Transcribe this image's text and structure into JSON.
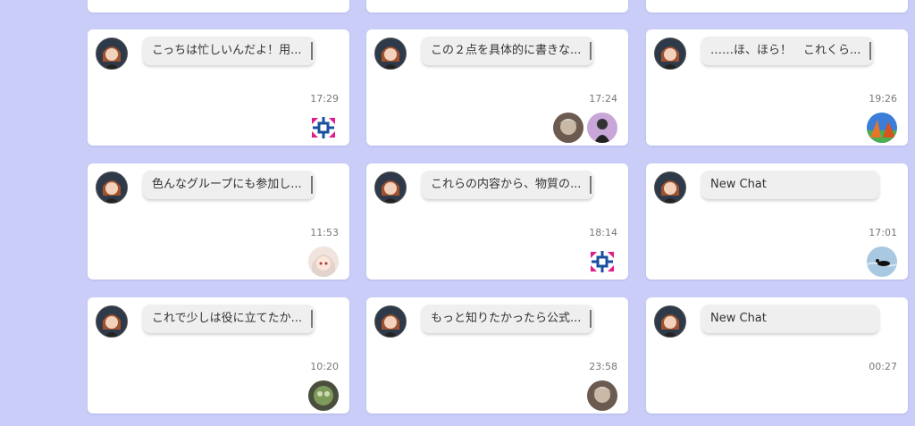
{
  "cards": [
    {
      "preview": "こっちは忙しいんだよ！用...",
      "time": "17:29",
      "bots": [
        "blue-pink-arrows-logo"
      ]
    },
    {
      "preview": "この２点を具体的に書きな...",
      "time": "17:24",
      "bots": [
        "grey-character-avatar",
        "purple-silhouette-avatar"
      ]
    },
    {
      "preview": "……ほ、ほら！　これくら...",
      "time": "19:26",
      "bots": [
        "landscape-avatar"
      ]
    },
    {
      "preview": "色んなグループにも参加し...",
      "time": "11:53",
      "bots": [
        "anime-girl-avatar"
      ]
    },
    {
      "preview": "これらの内容から、物質の...",
      "time": "18:14",
      "bots": [
        "blue-pink-arrows-logo"
      ]
    },
    {
      "preview": "New Chat",
      "time": "17:01",
      "bots": [
        "bird-on-water-avatar"
      ]
    },
    {
      "preview": "これで少しは役に立てたか...",
      "time": "10:20",
      "bots": [
        "green-character-avatar"
      ]
    },
    {
      "preview": "もっと知りたかったら公式...",
      "time": "23:58",
      "bots": [
        "grey-character-avatar"
      ]
    },
    {
      "preview": "New Chat",
      "time": "00:27",
      "bots": []
    }
  ]
}
